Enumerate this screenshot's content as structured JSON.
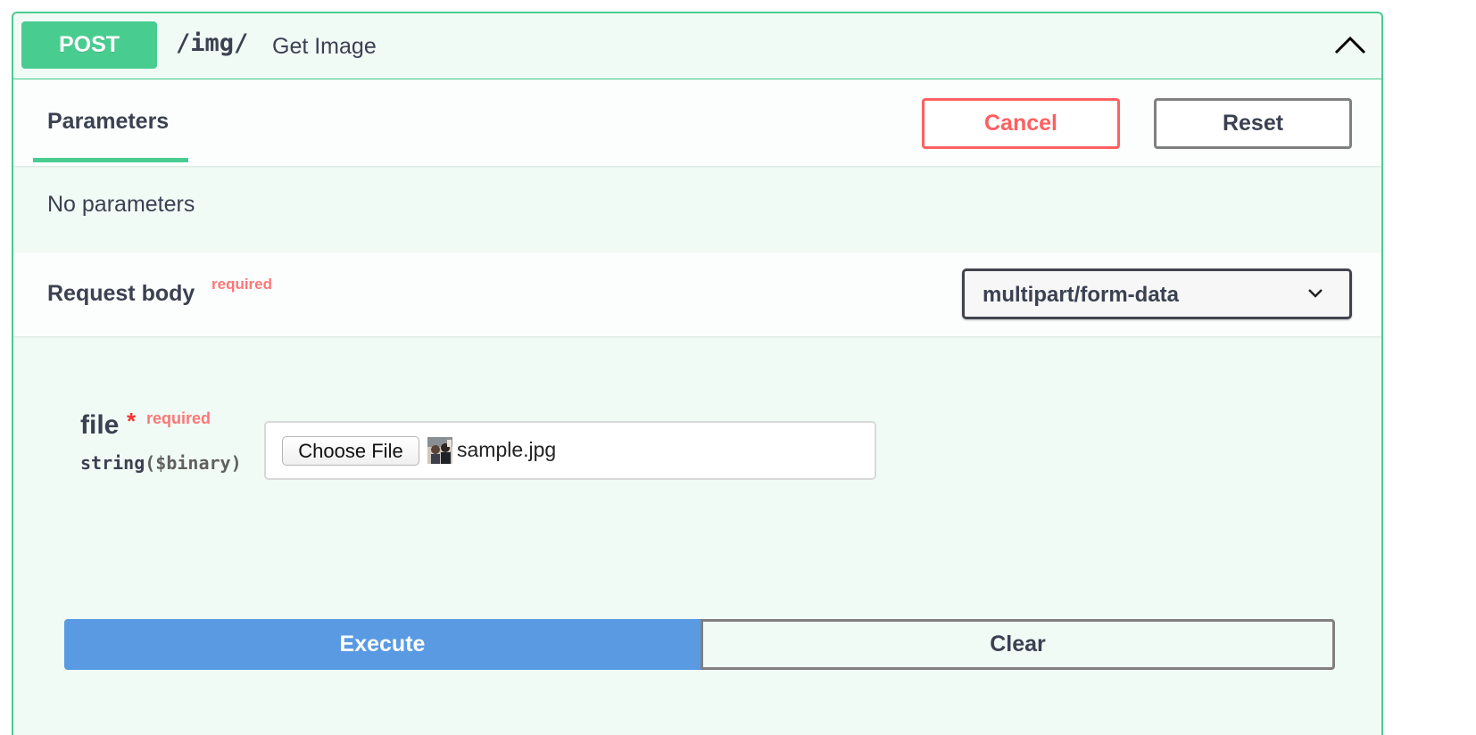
{
  "operation": {
    "method": "POST",
    "path": "/img/",
    "summary": "Get Image",
    "collapse_icon": "chevron-up-icon",
    "method_color": "#49cc90"
  },
  "parameters": {
    "tab_label": "Parameters",
    "cancel_label": "Cancel",
    "reset_label": "Reset",
    "empty_text": "No parameters"
  },
  "request_body": {
    "title": "Request body",
    "required_label": "required",
    "content_type": {
      "selected": "multipart/form-data",
      "icon": "chevron-down-icon"
    }
  },
  "file_param": {
    "name": "file",
    "required_star": "*",
    "required_label": "required",
    "type": "string",
    "format": "($binary)",
    "choose_label": "Choose File",
    "file_name": "sample.jpg",
    "thumbnail_icon": "image-thumbnail-icon"
  },
  "actions": {
    "execute_label": "Execute",
    "clear_label": "Clear",
    "execute_color": "#4990e2"
  },
  "colors": {
    "accent": "#49cc90",
    "danger": "#ff6060",
    "text": "#3b4151"
  }
}
